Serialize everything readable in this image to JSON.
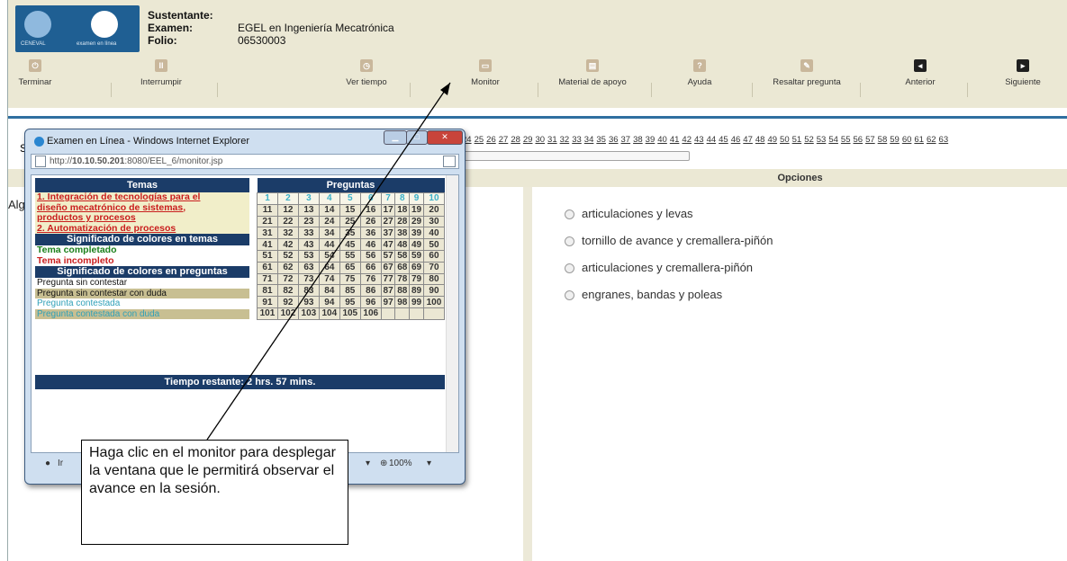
{
  "header": {
    "logo": {
      "brand_left": "CENEVAL",
      "brand_right": "examen en línea"
    },
    "info": [
      {
        "label": "Sustentante:",
        "value": ""
      },
      {
        "label": "Examen:",
        "value": "EGEL en Ingeniería Mecatrónica"
      },
      {
        "label": "Folio:",
        "value": "06530003"
      }
    ]
  },
  "toolbar": [
    {
      "label": "Terminar",
      "icon": "power-icon"
    },
    {
      "label": "Interrumpir",
      "icon": "pause-icon"
    },
    {
      "label": "Ver tiempo",
      "icon": "clock-icon"
    },
    {
      "label": "Monitor",
      "icon": "monitor-icon"
    },
    {
      "label": "Material de apoyo",
      "icon": "document-icon"
    },
    {
      "label": "Ayuda",
      "icon": "help-icon"
    },
    {
      "label": "Resaltar pregunta",
      "icon": "highlight-icon"
    },
    {
      "label": "Anterior",
      "icon": "previous-icon"
    },
    {
      "label": "Siguiente",
      "icon": "next-icon"
    }
  ],
  "question_numbers": [
    "24",
    "25",
    "26",
    "27",
    "28",
    "29",
    "30",
    "31",
    "32",
    "33",
    "34",
    "35",
    "36",
    "37",
    "38",
    "39",
    "40",
    "41",
    "42",
    "43",
    "44",
    "45",
    "46",
    "47",
    "48",
    "49",
    "50",
    "51",
    "52",
    "53",
    "54",
    "55",
    "56",
    "57",
    "58",
    "59",
    "60",
    "61",
    "62",
    "63"
  ],
  "left_fragments": {
    "s": "S",
    "alg": "Alg"
  },
  "options": {
    "header": "Opciones",
    "items": [
      "articulaciones y levas",
      "tornillo de avance y cremallera-piñón",
      "articulaciones y cremallera-piñón",
      "engranes, bandas y poleas"
    ]
  },
  "popup": {
    "title": "Examen en Línea - Windows Internet Explorer",
    "url_prefix": "http://",
    "url_host": "10.10.50.201",
    "url_rest": ":8080/EEL_6/monitor.jsp",
    "temas_header": "Temas",
    "temas": [
      "1. Integración de tecnologías para el",
      "diseño mecatrónico de sistemas,",
      "productos y procesos",
      "2. Automatización de procesos"
    ],
    "sig_temas_header": "Significado de colores en temas",
    "tema_completado": "Tema completado",
    "tema_incompleto": "Tema incompleto",
    "sig_preg_header": "Significado de colores en preguntas",
    "preg_legend": [
      "Pregunta sin contestar",
      "Pregunta sin contestar con duda",
      "Pregunta contestada",
      "Pregunta contestada con duda"
    ],
    "preguntas_header": "Preguntas",
    "preguntas_total": 106,
    "tiempo": "Tiempo restante: 2 hrs. 57 mins.",
    "status_left": "Ir",
    "zoom": "100%"
  },
  "callout": "Haga clic en el monitor para desplegar la ventana que le permitirá observar el avance en la sesión.",
  "colors": {
    "header_bg": "#ebe8d4",
    "navy": "#1b3c68",
    "accent_blue": "#2f6fa0"
  }
}
